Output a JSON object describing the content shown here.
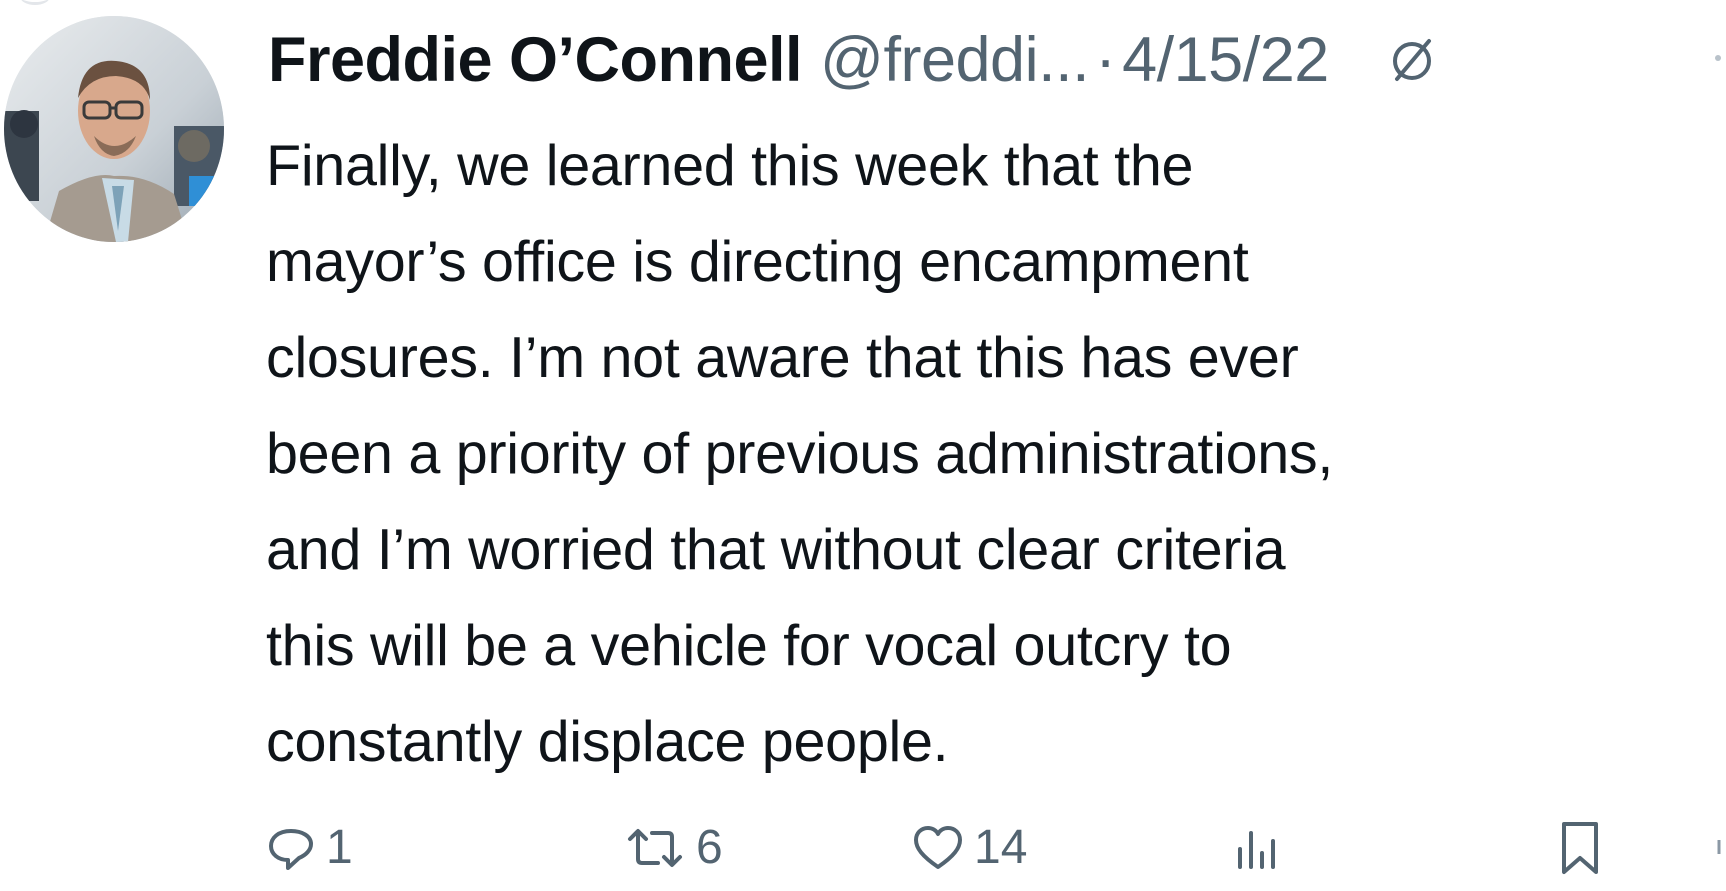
{
  "tweet": {
    "author_name": "Freddie O’Connell",
    "handle": "@freddi...",
    "separator": "·",
    "date": "4/15/22",
    "text": "Finally, we learned this week that the\nmayor’s office is directing encampment\nclosures. I’m not aware that this has ever\nbeen a priority of previous administrations,\nand I’m worried that without clear criteria\nthis will be a vehicle for vocal outcry to\nconstantly displace people.",
    "icons": {
      "avatar": "avatar-photo",
      "edited": "edited-icon",
      "more": "more-options-icon"
    }
  },
  "actions": {
    "reply": {
      "icon": "reply-icon",
      "count": "1"
    },
    "retweet": {
      "icon": "retweet-icon",
      "count": "6"
    },
    "like": {
      "icon": "heart-icon",
      "count": "14"
    },
    "views": {
      "icon": "analytics-icon",
      "count": ""
    },
    "bookmark": {
      "icon": "bookmark-icon",
      "count": ""
    }
  },
  "colors": {
    "text_primary": "#0f1419",
    "text_secondary": "#536471",
    "background": "#ffffff"
  }
}
